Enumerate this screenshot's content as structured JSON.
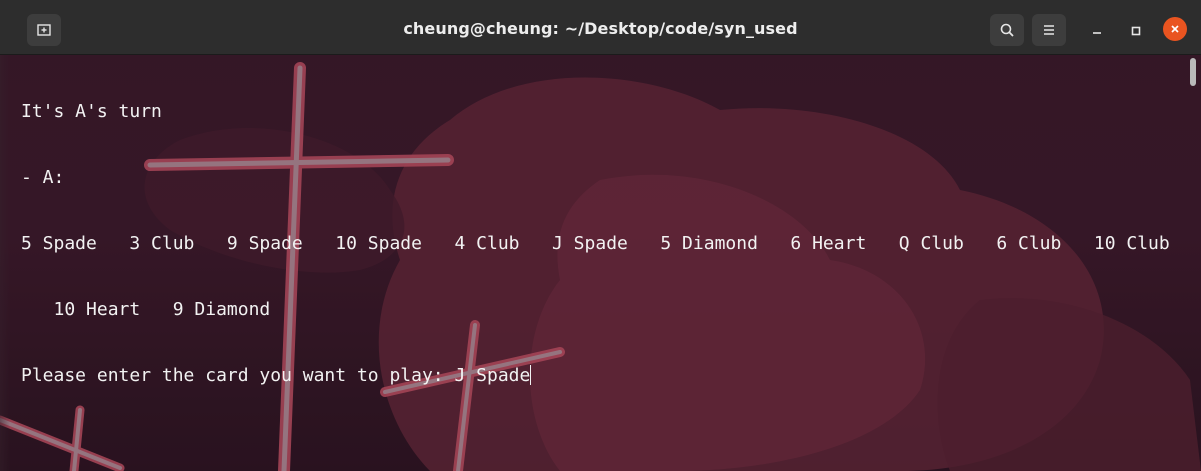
{
  "window": {
    "title": "cheung@cheung: ~/Desktop/code/syn_used"
  },
  "icons": {
    "new_tab": "new-tab-icon",
    "search": "search-icon",
    "menu": "hamburger-menu-icon",
    "minimize": "minimize-icon",
    "maximize": "maximize-icon",
    "close": "close-icon"
  },
  "colors": {
    "titlebar": "#2d2d2d",
    "close_button": "#e95420",
    "terminal_text": "#f2f2f2"
  },
  "terminal": {
    "lines": [
      "It's A's turn",
      "- A:",
      "5 Spade   3 Club   9 Spade   10 Spade   4 Club   J Spade   5 Diamond   6 Heart   Q Club   6 Club   10 Club",
      "   10 Heart   9 Diamond",
      "Please enter the card you want to play: J Spade"
    ]
  }
}
